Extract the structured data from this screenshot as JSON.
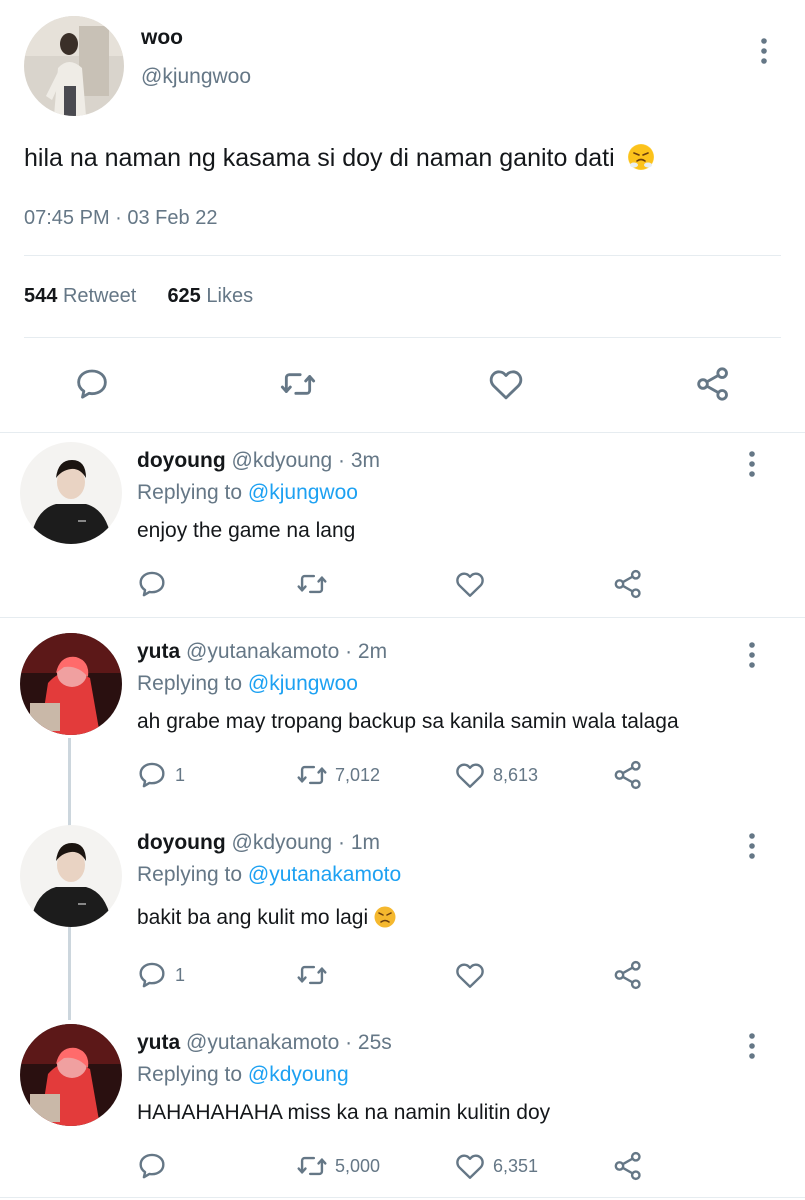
{
  "main_tweet": {
    "name": "woo",
    "handle": "@kjungwoo",
    "text": "hila na naman ng kasama si doy di naman ganito dati",
    "emoji": "steam-nose-emoji",
    "timestamp": "07:45 PM · 03 Feb 22",
    "retweets_count": "544",
    "retweets_label": "Retweet",
    "likes_count": "625",
    "likes_label": "Likes"
  },
  "replies": [
    {
      "name": "doyoung",
      "meta": "@kdyoung · 3m",
      "replying_label": "Replying to",
      "replying_to": "@kjungwoo",
      "text": "enjoy the game na lang",
      "reply_count": "",
      "retweet_count": "",
      "like_count": ""
    },
    {
      "name": "yuta",
      "meta": "@yutanakamoto · 2m",
      "replying_label": "Replying to",
      "replying_to": "@kjungwoo",
      "text": "ah grabe may tropang backup sa kanila samin wala talaga",
      "reply_count": "1",
      "retweet_count": "7,012",
      "like_count": "8,613"
    },
    {
      "name": "doyoung",
      "meta": "@kdyoung · 1m",
      "replying_label": "Replying to",
      "replying_to": "@yutanakamoto",
      "text": "bakit ba ang kulit mo lagi",
      "reply_count": "1",
      "retweet_count": "",
      "like_count": ""
    },
    {
      "name": "yuta",
      "meta": "@yutanakamoto · 25s",
      "replying_label": "Replying to",
      "replying_to": "@kdyoung",
      "text": "HAHAHAHAHA miss ka na namin kulitin doy",
      "reply_count": "",
      "retweet_count": "5,000",
      "like_count": "6,351"
    }
  ],
  "colors": {
    "link": "#1da1f2",
    "secondary": "#657786",
    "divider": "#e6ecf0",
    "thread_line": "#ccd6dd"
  },
  "icons": [
    "comment-icon",
    "retweet-icon",
    "like-icon",
    "share-icon",
    "more-icon"
  ]
}
